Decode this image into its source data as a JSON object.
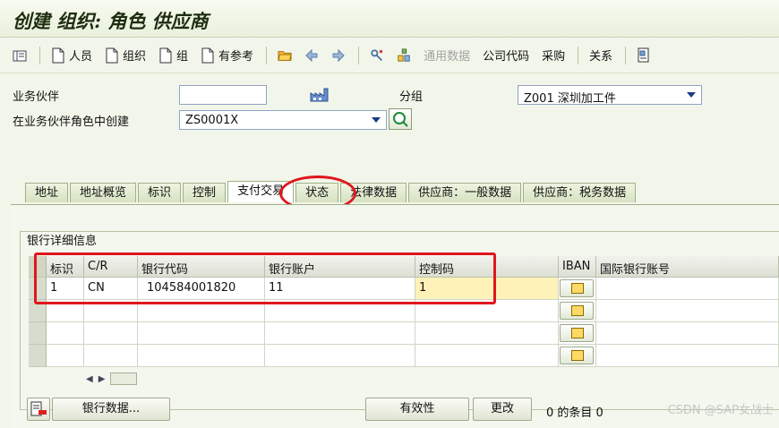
{
  "window": {
    "title": "创建 组织: 角色 供应商"
  },
  "toolbar": {
    "buttons": [
      {
        "label": "",
        "icon": "display-icon"
      },
      {
        "label": "人员",
        "icon": "new-document-icon"
      },
      {
        "label": "组织",
        "icon": "new-document-icon"
      },
      {
        "label": "组",
        "icon": "new-document-icon"
      },
      {
        "label": "有参考",
        "icon": "new-document-icon"
      }
    ],
    "general_data_label": "通用数据",
    "company_code_label": "公司代码",
    "purchasing_label": "采购",
    "relations_label": "关系"
  },
  "form": {
    "bp_label": "业务伙伴",
    "bp_value": "",
    "group_label": "分组",
    "group_value": "Z001 深圳加工件",
    "role_label": "在业务伙伴角色中创建",
    "role_value": "ZS0001X"
  },
  "tabs": [
    "地址",
    "地址概览",
    "标识",
    "控制",
    "支付交易",
    "状态",
    "法律数据",
    "供应商：一般数据",
    "供应商：税务数据"
  ],
  "active_tab": "支付交易",
  "bank_group": {
    "title": "银行详细信息",
    "columns": [
      "标识",
      "C/R",
      "银行代码",
      "银行账户",
      "控制码",
      "IBAN",
      "国际银行账号"
    ],
    "rows": [
      {
        "id": "1",
        "cr": "CN",
        "bank_code": "104584001820",
        "account": "11",
        "control": "1",
        "intl": ""
      },
      {
        "id": "",
        "cr": "",
        "bank_code": "",
        "account": "",
        "control": "",
        "intl": ""
      },
      {
        "id": "",
        "cr": "",
        "bank_code": "",
        "account": "",
        "control": "",
        "intl": ""
      },
      {
        "id": "",
        "cr": "",
        "bank_code": "",
        "account": "",
        "control": "",
        "intl": ""
      }
    ]
  },
  "bottom": {
    "bank_data_btn": "银行数据...",
    "validity_btn": "有效性",
    "change_btn": "更改",
    "entries_text": "0 的条目 0"
  },
  "watermark": "CSDN @SAP女战士"
}
